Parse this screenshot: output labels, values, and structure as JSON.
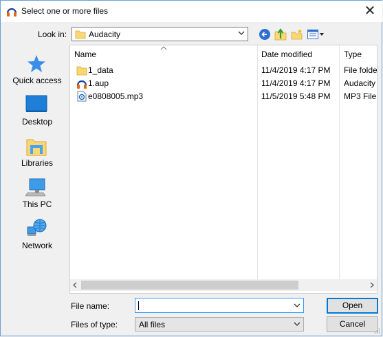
{
  "window": {
    "title": "Select one or more files",
    "close": "✕"
  },
  "lookin": {
    "label": "Look in:",
    "value": "Audacity"
  },
  "places": [
    {
      "label": "Quick access",
      "icon": "star-icon"
    },
    {
      "label": "Desktop",
      "icon": "desktop-icon"
    },
    {
      "label": "Libraries",
      "icon": "libraries-icon"
    },
    {
      "label": "This PC",
      "icon": "computer-icon"
    },
    {
      "label": "Network",
      "icon": "network-icon"
    }
  ],
  "columns": {
    "name": "Name",
    "date": "Date modified",
    "type": "Type"
  },
  "files": [
    {
      "name": "1_data",
      "date": "11/4/2019 4:17 PM",
      "type": "File folder",
      "icon": "folder-icon"
    },
    {
      "name": "1.aup",
      "date": "11/4/2019 4:17 PM",
      "type": "Audacity Project",
      "icon": "audacity-icon"
    },
    {
      "name": "e0808005.mp3",
      "date": "11/5/2019 5:48 PM",
      "type": "MP3 File",
      "icon": "mp3-file-icon"
    }
  ],
  "filename": {
    "label": "File name:",
    "value": ""
  },
  "filetype": {
    "label": "Files of type:",
    "value": "All files"
  },
  "buttons": {
    "open": "Open",
    "cancel": "Cancel"
  },
  "colors": {
    "accent": "#0078d7",
    "folder": "#f8d775"
  }
}
